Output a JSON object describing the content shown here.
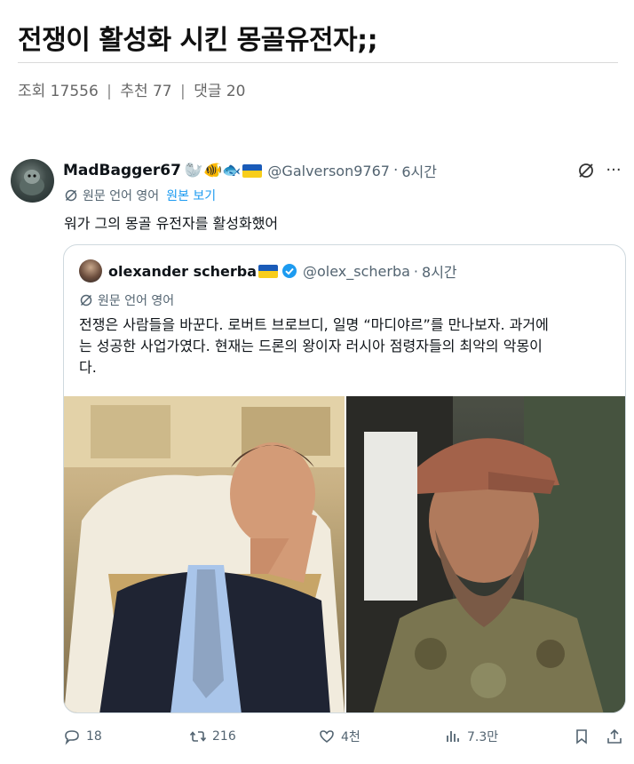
{
  "post": {
    "title": "전쟁이 활성화 시킨 몽골유전자;;",
    "stats": {
      "views_label": "조회 17556",
      "recommend_label": "추천 77",
      "comments_label": "댓글 20",
      "separator": "|"
    }
  },
  "tweet": {
    "display_name": "MadBagger67",
    "emojis": "🦭🐠🐟",
    "flag_icon": "ukraine-flag-icon",
    "handle": "@Galverson9767",
    "dot": "·",
    "time": "6시간",
    "translate_label": "원문 언어 영어",
    "show_original": "원본 보기",
    "text": "워가 그의 몽골 유전자를 활성화했어",
    "more": "···",
    "quote": {
      "display_name": "olexander scherba",
      "handle": "@olex_scherba",
      "dot": "·",
      "time": "8시간",
      "translate_label": "원문 언어 영어",
      "text": "전쟁은 사람들을 바꾼다. 로버트 브로브디, 일명 “마디야르”를 만나보자. 과거에\n는 성공한 사업가였다. 현재는 드론의 왕이자 러시아 점령자들의 최악의 악몽이\n다.",
      "images": [
        "man-in-suit-photo",
        "bearded-man-in-cap-photo"
      ]
    },
    "actions": {
      "replies": "18",
      "retweets": "216",
      "likes": "4천",
      "views": "7.3만"
    }
  },
  "colors": {
    "accent": "#1d9bf0",
    "muted": "#536471",
    "border": "#cfd9de"
  }
}
